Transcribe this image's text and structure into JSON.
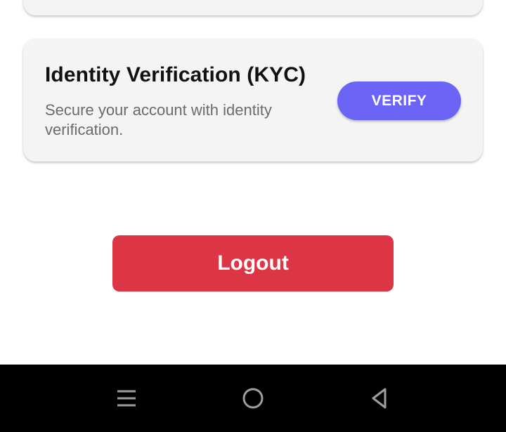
{
  "kyc_card": {
    "title": "Identity Verification (KYC)",
    "description": "Secure your account with identity verification.",
    "button_label": "VERIFY"
  },
  "logout": {
    "label": "Logout"
  },
  "colors": {
    "card_background": "#f4f4f4",
    "verify_button": "#6c63f7",
    "logout_button": "#dc3545",
    "nav_bar": "#000000"
  },
  "nav_bar": {
    "icons": [
      "recents-icon",
      "home-icon",
      "back-icon"
    ]
  }
}
